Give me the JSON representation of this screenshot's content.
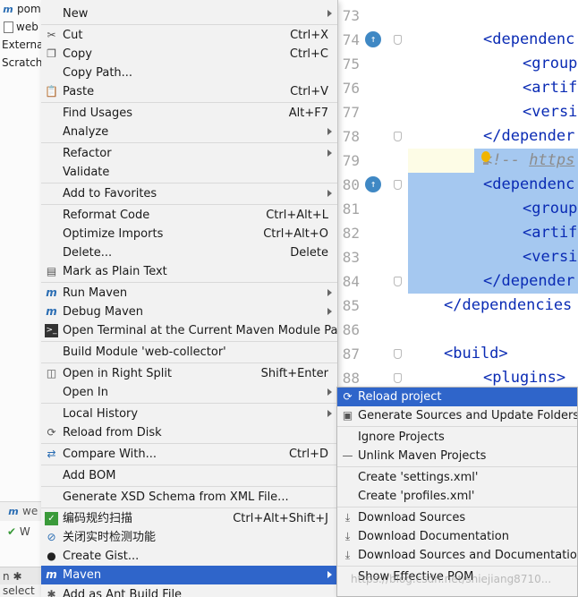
{
  "project_tree": {
    "rows": [
      {
        "label": "pom"
      },
      {
        "label": "web"
      },
      {
        "label": "Externa"
      },
      {
        "label": "Scratch"
      }
    ],
    "bottom_tool_label": "we",
    "bottom_row_label": "W",
    "bottom_bar_label": "n",
    "status_label": "select"
  },
  "editor": {
    "lines": [
      {
        "no": "73",
        "code": ""
      },
      {
        "no": "74",
        "code": "<dependenc"
      },
      {
        "no": "75",
        "code": "<group"
      },
      {
        "no": "76",
        "code": "<artif"
      },
      {
        "no": "77",
        "code": "<versi"
      },
      {
        "no": "78",
        "code": "</depender"
      },
      {
        "no": "79",
        "code_comment": "<!-- ",
        "code_link": "https"
      },
      {
        "no": "80",
        "code": "<dependenc"
      },
      {
        "no": "81",
        "code": "<group"
      },
      {
        "no": "82",
        "code": "<artif"
      },
      {
        "no": "83",
        "code": "<versi"
      },
      {
        "no": "84",
        "code": "</depender"
      },
      {
        "no": "85",
        "code": "</dependencies"
      },
      {
        "no": "86",
        "code": ""
      },
      {
        "no": "87",
        "code": "<build>"
      },
      {
        "no": "88",
        "code": "<plugins>"
      }
    ]
  },
  "context_menu": {
    "items": [
      {
        "label": "New",
        "shortcut": "",
        "icon": "",
        "submenu": true
      },
      {
        "label": "Cut",
        "shortcut": "Ctrl+X",
        "icon": "scissors-icon",
        "submenu": false
      },
      {
        "label": "Copy",
        "shortcut": "Ctrl+C",
        "icon": "copy-icon",
        "submenu": false
      },
      {
        "label": "Copy Path...",
        "shortcut": "",
        "icon": "",
        "submenu": false
      },
      {
        "label": "Paste",
        "shortcut": "Ctrl+V",
        "icon": "clipboard-icon",
        "submenu": false
      },
      {
        "label": "Find Usages",
        "shortcut": "Alt+F7",
        "icon": "",
        "submenu": false
      },
      {
        "label": "Analyze",
        "shortcut": "",
        "icon": "",
        "submenu": true
      },
      {
        "label": "Refactor",
        "shortcut": "",
        "icon": "",
        "submenu": true
      },
      {
        "label": "Validate",
        "shortcut": "",
        "icon": "",
        "submenu": false
      },
      {
        "label": "Add to Favorites",
        "shortcut": "",
        "icon": "",
        "submenu": true
      },
      {
        "label": "Reformat Code",
        "shortcut": "Ctrl+Alt+L",
        "icon": "",
        "submenu": false
      },
      {
        "label": "Optimize Imports",
        "shortcut": "Ctrl+Alt+O",
        "icon": "",
        "submenu": false
      },
      {
        "label": "Delete...",
        "shortcut": "Delete",
        "icon": "",
        "submenu": false
      },
      {
        "label": "Mark as Plain Text",
        "shortcut": "",
        "icon": "plain-text-icon",
        "submenu": false
      },
      {
        "label": "Run Maven",
        "shortcut": "",
        "icon": "run-maven-icon",
        "submenu": true
      },
      {
        "label": "Debug Maven",
        "shortcut": "",
        "icon": "debug-maven-icon",
        "submenu": true
      },
      {
        "label": "Open Terminal at the Current Maven Module Path",
        "shortcut": "",
        "icon": "terminal-icon",
        "submenu": false
      },
      {
        "label": "Build Module 'web-collector'",
        "shortcut": "",
        "icon": "",
        "submenu": false
      },
      {
        "label": "Open in Right Split",
        "shortcut": "Shift+Enter",
        "icon": "split-icon",
        "submenu": false
      },
      {
        "label": "Open In",
        "shortcut": "",
        "icon": "",
        "submenu": true
      },
      {
        "label": "Local History",
        "shortcut": "",
        "icon": "",
        "submenu": true
      },
      {
        "label": "Reload from Disk",
        "shortcut": "",
        "icon": "reload-icon",
        "submenu": false
      },
      {
        "label": "Compare With...",
        "shortcut": "Ctrl+D",
        "icon": "compare-icon",
        "submenu": false
      },
      {
        "label": "Add BOM",
        "shortcut": "",
        "icon": "",
        "submenu": false
      },
      {
        "label": "Generate XSD Schema from XML File...",
        "shortcut": "",
        "icon": "",
        "submenu": false
      },
      {
        "label": "编码规约扫描",
        "shortcut": "Ctrl+Alt+Shift+J",
        "icon": "scan-icon",
        "submenu": false
      },
      {
        "label": "关闭实时检测功能",
        "shortcut": "",
        "icon": "disable-icon",
        "submenu": false
      },
      {
        "label": "Create Gist...",
        "shortcut": "",
        "icon": "github-icon",
        "submenu": false
      },
      {
        "label": "Maven",
        "shortcut": "",
        "icon": "maven-icon",
        "submenu": true,
        "active": true
      },
      {
        "label": "Add as Ant Build File",
        "shortcut": "",
        "icon": "ant-icon",
        "submenu": false
      }
    ]
  },
  "maven_submenu": {
    "items": [
      {
        "label": "Reload project",
        "icon": "reload-icon",
        "active": true
      },
      {
        "label": "Generate Sources and Update Folders",
        "icon": "generate-sources-icon"
      },
      {
        "label": "Ignore Projects",
        "icon": ""
      },
      {
        "label": "Unlink Maven Projects",
        "icon": "minus-icon"
      },
      {
        "label": "Create 'settings.xml'",
        "icon": ""
      },
      {
        "label": "Create 'profiles.xml'",
        "icon": ""
      },
      {
        "label": "Download Sources",
        "icon": "download-icon"
      },
      {
        "label": "Download Documentation",
        "icon": "download-icon"
      },
      {
        "label": "Download Sources and Documentation",
        "icon": "download-icon"
      },
      {
        "label": "Show Effective POM",
        "icon": ""
      }
    ]
  },
  "watermark": "https://blog.csdn.net/shiejiang8710..."
}
